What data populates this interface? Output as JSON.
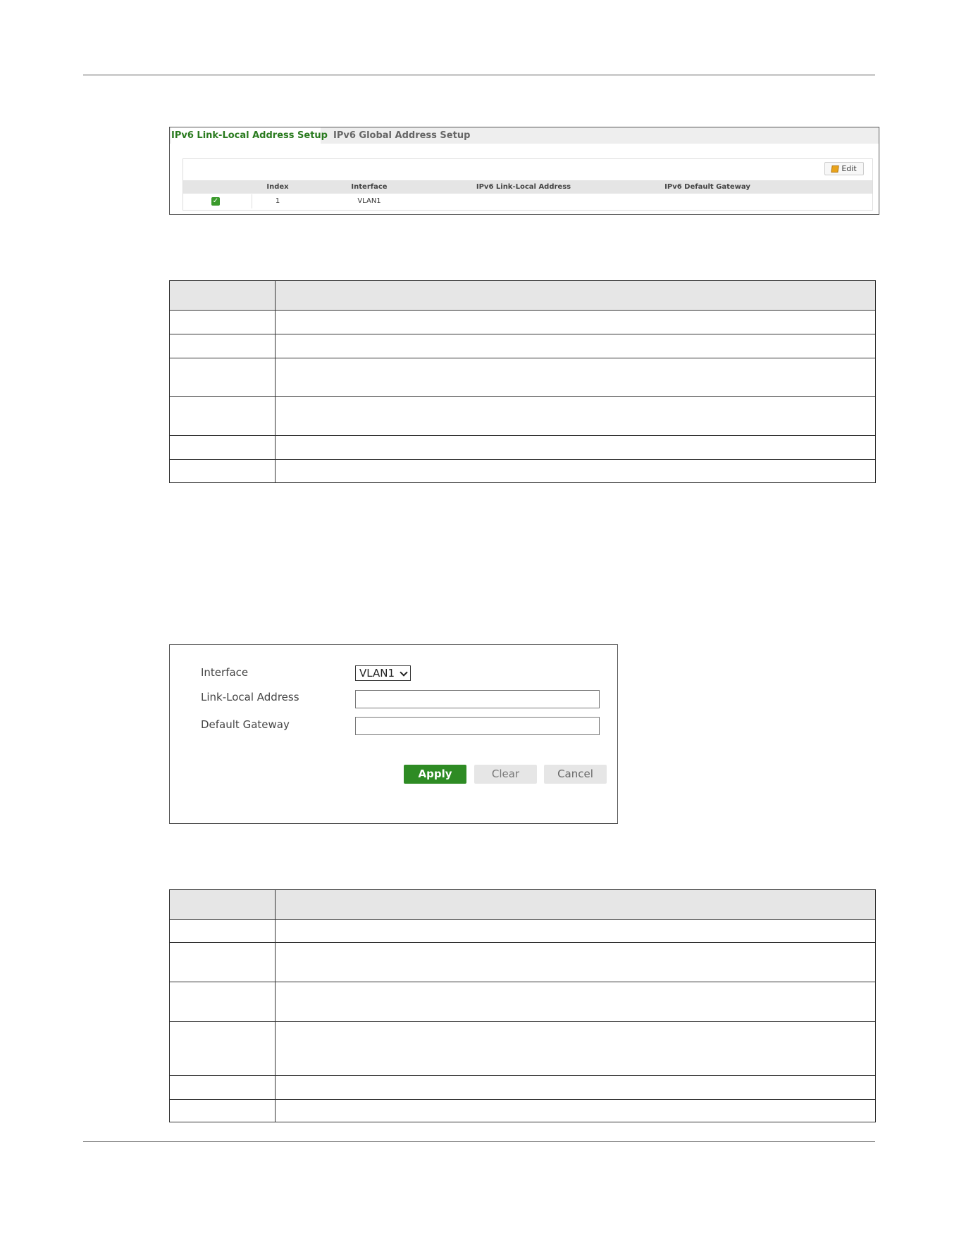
{
  "tabs": [
    {
      "label": "IPv6 Link-Local Address Setup",
      "active": true
    },
    {
      "label": "IPv6 Global Address Setup",
      "active": false
    }
  ],
  "list": {
    "edit_label": "Edit",
    "columns": [
      "Index",
      "Interface",
      "IPv6 Link-Local Address",
      "IPv6 Default Gateway"
    ],
    "rows": [
      {
        "checked": true,
        "index": "1",
        "interface": "VLAN1",
        "link_local": "",
        "gateway": ""
      }
    ]
  },
  "edit_form": {
    "fields": {
      "interface_label": "Interface",
      "link_local_label": "Link-Local Address",
      "gateway_label": "Default Gateway"
    },
    "interface_value": "VLAN1",
    "link_local_value": "",
    "gateway_value": "",
    "buttons": {
      "apply": "Apply",
      "clear": "Clear",
      "cancel": "Cancel"
    }
  },
  "colors": {
    "accent_green": "#2e8b24",
    "tab_active_text": "#2a7b1f",
    "header_gray": "#e6e6e6"
  }
}
